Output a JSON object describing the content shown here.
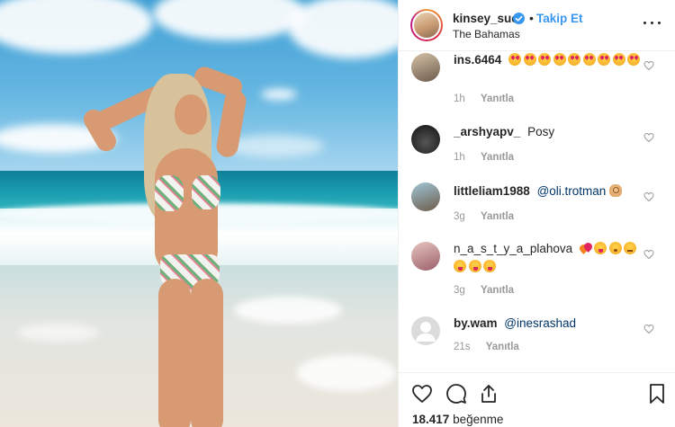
{
  "post": {
    "username": "kinsey_sue",
    "follow_label": "Takip Et",
    "separator": "•",
    "location": "The Bahamas",
    "icons": {
      "verified": "verified-badge-icon",
      "more": "more-options-icon"
    }
  },
  "comments": [
    {
      "username": "ins.6464",
      "text": "",
      "emojis": [
        "heart-eyes",
        "heart-eyes",
        "heart-eyes",
        "heart-eyes",
        "heart-eyes",
        "heart-eyes",
        "heart-eyes",
        "heart-eyes",
        "heart-eyes"
      ],
      "time": "1h",
      "reply_label": "Yanıtla"
    },
    {
      "username": "_arshyapv_",
      "text": "Posy",
      "emojis": [],
      "time": "1h",
      "reply_label": "Yanıtla"
    },
    {
      "username": "littleliam1988",
      "mention": "@oli.trotman",
      "emojis": [
        "ok-hand"
      ],
      "time": "3g",
      "reply_label": "Yanıtla"
    },
    {
      "username": "n_a_s_t_y_a_plahova",
      "text": "",
      "emojis": [
        "hearts",
        "yum",
        "kiss",
        "smirk",
        "yum",
        "yum",
        "yum"
      ],
      "time": "3g",
      "reply_label": "Yanıtla"
    },
    {
      "username": "by.wam",
      "mention": "@inesrashad",
      "emojis": [],
      "time": "21s",
      "reply_label": "Yanıtla"
    }
  ],
  "footer": {
    "likes_count": "18.417",
    "likes_label": "beğenme",
    "icons": [
      "heart-icon",
      "comment-icon",
      "share-icon",
      "bookmark-icon"
    ]
  },
  "colors": {
    "link_blue": "#3897f0",
    "mention_blue": "#003569",
    "meta_gray": "#999999",
    "text": "#262626"
  }
}
